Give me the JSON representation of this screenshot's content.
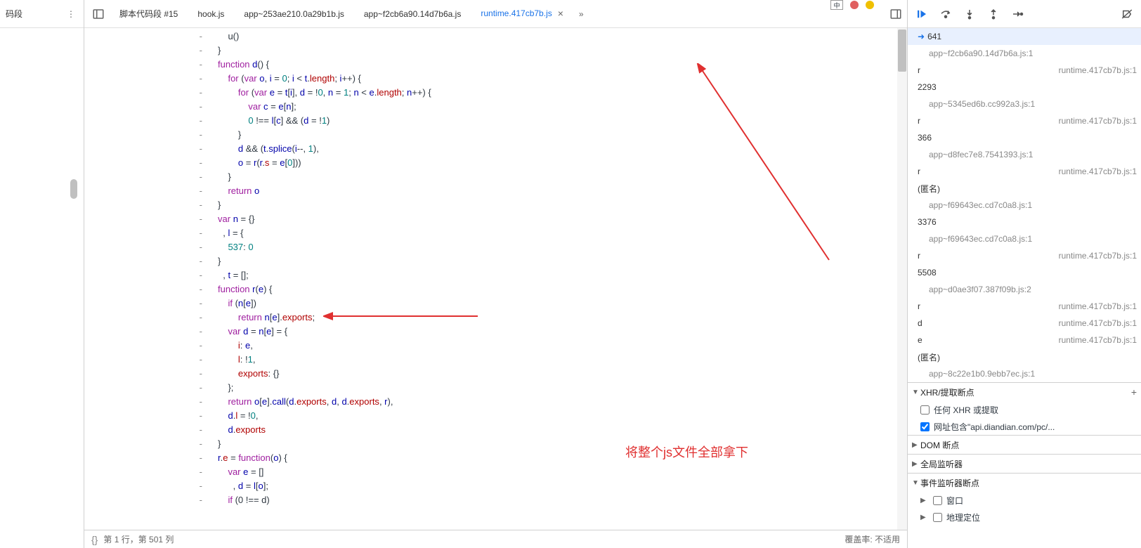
{
  "leftSidebar": {
    "title": "码段"
  },
  "tabs": [
    {
      "label": "脚本代码段 #15",
      "active": false
    },
    {
      "label": "hook.js",
      "active": false
    },
    {
      "label": "app~253ae210.0a29b1b.js",
      "active": false
    },
    {
      "label": "app~f2cb6a90.14d7b6a.js",
      "active": false
    },
    {
      "label": "runtime.417cb7b.js",
      "active": true,
      "closable": true
    }
  ],
  "gutterMarks": [
    "-",
    "-",
    "-",
    "-",
    "-",
    "-",
    "-",
    "-",
    "-",
    "-",
    "-",
    "-",
    "-",
    "-",
    "-",
    "-",
    "-",
    "-",
    "-",
    "-",
    "-",
    "-",
    "-",
    "-",
    "-",
    "-",
    "-",
    "-",
    "-",
    "-",
    "-",
    "-",
    "-",
    "-"
  ],
  "code": [
    "    u()",
    "}",
    "<kw>function</kw> <fn>d</fn>() {",
    "    <kw>for</kw> (<kw>var</kw> <var>o</var>, <var>i</var> = <num>0</num>; <var>i</var> &lt; <var>t</var>.<prop>length</prop>; <var>i</var>++) {",
    "        <kw>for</kw> (<kw>var</kw> <var>e</var> = <var>t</var>[<var>i</var>], <var>d</var> = !<num>0</num>, <var>n</var> = <num>1</num>; <var>n</var> &lt; <var>e</var>.<prop>length</prop>; <var>n</var>++) {",
    "            <kw>var</kw> <var>c</var> = <var>e</var>[<var>n</var>];",
    "            <num>0</num> !== <var>l</var>[<var>c</var>] &amp;&amp; (<var>d</var> = !<num>1</num>)",
    "        }",
    "        <var>d</var> &amp;&amp; (<var>t</var>.<fn>splice</fn>(<var>i</var>--, <num>1</num>),",
    "        <var>o</var> = <fn>r</fn>(<var>r</var>.<prop>s</prop> = <var>e</var>[<num>0</num>]))",
    "    }",
    "    <kw>return</kw> <var>o</var>",
    "}",
    "<kw>var</kw> <var>n</var> = {}",
    "  , <var>l</var> = {",
    "    <num>537</num>: <num>0</num>",
    "}",
    "  , <var>t</var> = [];",
    "<kw>function</kw> <fn>r</fn>(<var>e</var>) {",
    "    <kw>if</kw> (<var>n</var>[<var>e</var>])",
    "        <kw>return</kw> <var>n</var>[<var>e</var>].<prop>exports</prop>;",
    "    <kw>var</kw> <var>d</var> = <var>n</var>[<var>e</var>] = {",
    "        <prop>i</prop>: <var>e</var>,",
    "        <prop>l</prop>: !<num>1</num>,",
    "        <prop>exports</prop>: {}",
    "    };",
    "    <kw>return</kw> <var>o</var>[<var>e</var>].<fn>call</fn>(<var>d</var>.<prop>exports</prop>, <var>d</var>, <var>d</var>.<prop>exports</prop>, <var>r</var>),",
    "    <var>d</var>.<prop>l</prop> = !<num>0</num>,",
    "    <var>d</var>.<prop>exports</prop>",
    "}",
    "<var>r</var>.<prop>e</prop> = <kw>function</kw>(<var>o</var>) {",
    "    <kw>var</kw> <var>e</var> = []",
    "      , <var>d</var> = <var>l</var>[<var>o</var>];",
    "    <kw>if</kw> (0 !== d)"
  ],
  "annotation": "将整个js文件全部拿下",
  "statusBar": {
    "left": "第 1 行，第 501 列",
    "right": "覆盖率: 不适用"
  },
  "callstack": [
    {
      "fn": "641",
      "loc": "",
      "current": true
    },
    {
      "sub": "app~f2cb6a90.14d7b6a.js:1"
    },
    {
      "fn": "r",
      "loc": "runtime.417cb7b.js:1"
    },
    {
      "fn": "2293",
      "loc": ""
    },
    {
      "sub": "app~5345ed6b.cc992a3.js:1"
    },
    {
      "fn": "r",
      "loc": "runtime.417cb7b.js:1"
    },
    {
      "fn": "366",
      "loc": ""
    },
    {
      "sub": "app~d8fec7e8.7541393.js:1"
    },
    {
      "fn": "r",
      "loc": "runtime.417cb7b.js:1"
    },
    {
      "fn": "(匿名)",
      "loc": ""
    },
    {
      "sub": "app~f69643ec.cd7c0a8.js:1"
    },
    {
      "fn": "3376",
      "loc": ""
    },
    {
      "sub": "app~f69643ec.cd7c0a8.js:1"
    },
    {
      "fn": "r",
      "loc": "runtime.417cb7b.js:1"
    },
    {
      "fn": "5508",
      "loc": ""
    },
    {
      "sub": "app~d0ae3f07.387f09b.js:2"
    },
    {
      "fn": "r",
      "loc": "runtime.417cb7b.js:1"
    },
    {
      "fn": "d",
      "loc": "runtime.417cb7b.js:1"
    },
    {
      "fn": "e",
      "loc": "runtime.417cb7b.js:1"
    },
    {
      "fn": "(匿名)",
      "loc": ""
    },
    {
      "sub": "app~8c22e1b0.9ebb7ec.js:1"
    }
  ],
  "sections": {
    "xhr": {
      "title": "XHR/提取断点",
      "expanded": true
    },
    "xhrItems": [
      {
        "checked": false,
        "label": "任何 XHR 或提取"
      },
      {
        "checked": true,
        "label": "网址包含\"api.diandian.com/pc/..."
      }
    ],
    "dom": {
      "title": "DOM 断点",
      "expanded": false
    },
    "global": {
      "title": "全局监听器",
      "expanded": false
    },
    "event": {
      "title": "事件监听器断点",
      "expanded": true
    },
    "eventItems": [
      {
        "checked": false,
        "label": "窗口",
        "expand": false
      },
      {
        "checked": false,
        "label": "地理定位",
        "expand": false
      }
    ]
  },
  "lang": {
    "ime": "中"
  }
}
